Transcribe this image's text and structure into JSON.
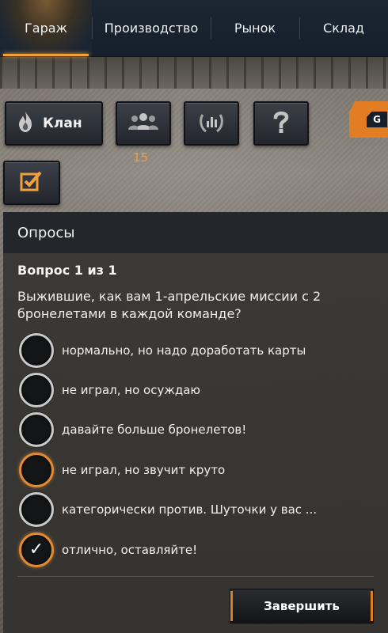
{
  "nav": {
    "tabs": [
      {
        "label": "Гараж",
        "active": true
      },
      {
        "label": "Производство",
        "active": false
      },
      {
        "label": "Рынок",
        "active": false
      },
      {
        "label": "Склад",
        "active": false
      }
    ]
  },
  "toolbar": {
    "clan_label": "Клан",
    "friends_count": "15",
    "side_tab_letter": "G",
    "icons": [
      "flame-icon",
      "group-icon",
      "rating-icon",
      "help-icon",
      "tasks-icon"
    ]
  },
  "poll": {
    "title": "Опросы",
    "question_number": "Вопрос 1 из 1",
    "question_text": "Выжившие, как вам 1-апрельские миссии с 2 бронелетами в каждой команде?",
    "options": [
      {
        "label": "нормально, но надо доработать карты",
        "selected": false
      },
      {
        "label": "не играл, но осуждаю",
        "selected": false
      },
      {
        "label": "давайте больше бронелетов!",
        "selected": false
      },
      {
        "label": "не играл, но звучит круто",
        "selected": false
      },
      {
        "label": "категорически против. Шуточки у вас ...",
        "selected": false
      },
      {
        "label": "отлично, оставляйте!",
        "selected": true
      }
    ],
    "finish_label": "Завершить"
  },
  "colors": {
    "accent": "#f0a03c",
    "nav_bg": "#1b2633",
    "panel_bg": "#3a3835"
  }
}
